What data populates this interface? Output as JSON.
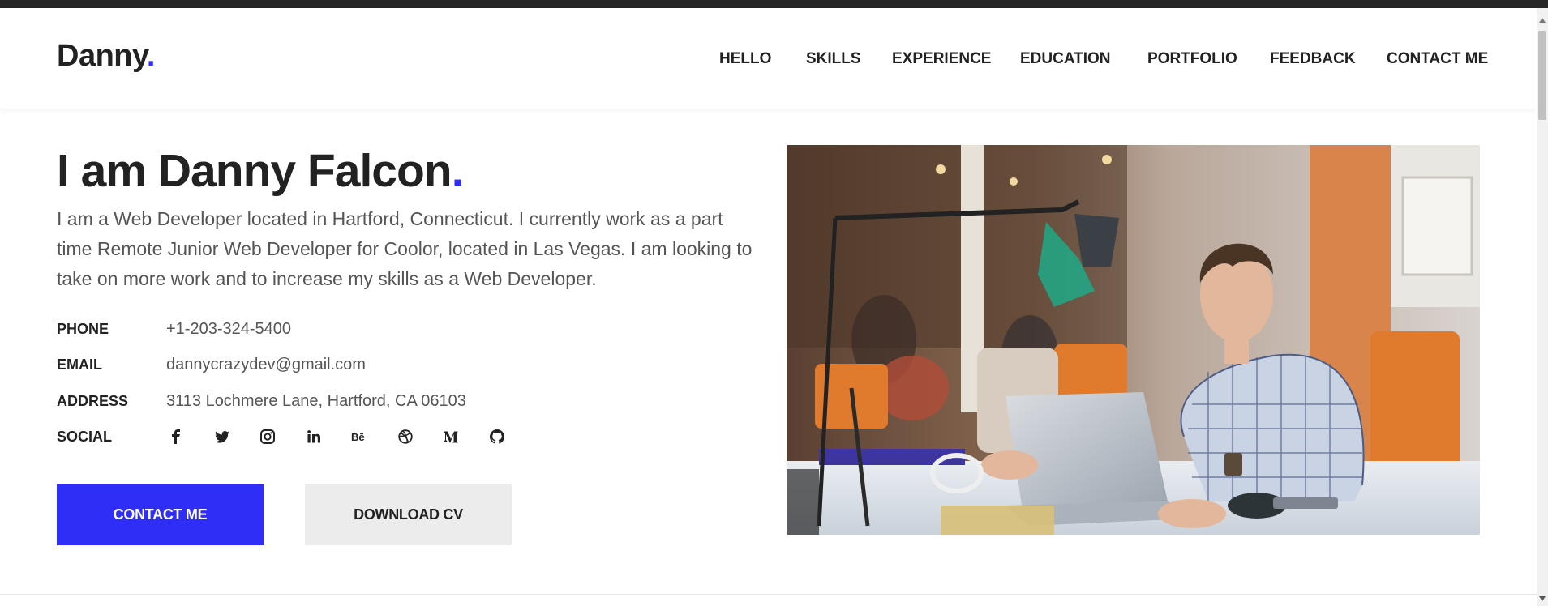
{
  "brand": {
    "name": "Danny",
    "dot": "."
  },
  "nav": {
    "items": [
      {
        "label": "HELLO"
      },
      {
        "label": "SKILLS"
      },
      {
        "label": "EXPERIENCE"
      },
      {
        "label": "EDUCATION"
      },
      {
        "label": "PORTFOLIO"
      },
      {
        "label": "FEEDBACK"
      },
      {
        "label": "CONTACT ME"
      }
    ]
  },
  "hero": {
    "title": "I am Danny Falcon",
    "title_dot": ".",
    "bio": "I am a Web Developer located in Hartford, Connecticut. I currently work as a part time Remote Junior Web Developer for Coolor, located in Las Vegas. I am looking to take on more work and to increase my skills as a Web Developer."
  },
  "info": {
    "phone_label": "PHONE",
    "phone": "+1-203-324-5400",
    "email_label": "EMAIL",
    "email": "dannycrazydev@gmail.com",
    "address_label": "ADDRESS",
    "address": "3113 Lochmere Lane, Hartford, CA 06103",
    "social_label": "SOCIAL"
  },
  "social": [
    "facebook-icon",
    "twitter-icon",
    "instagram-icon",
    "linkedin-icon",
    "behance-icon",
    "dribbble-icon",
    "medium-icon",
    "github-icon"
  ],
  "buttons": {
    "contact": "CONTACT ME",
    "download": "DOWNLOAD CV"
  },
  "colors": {
    "accent": "#2f2ef7",
    "text": "#222222",
    "muted": "#555555",
    "secondary_button": "#ececec"
  }
}
